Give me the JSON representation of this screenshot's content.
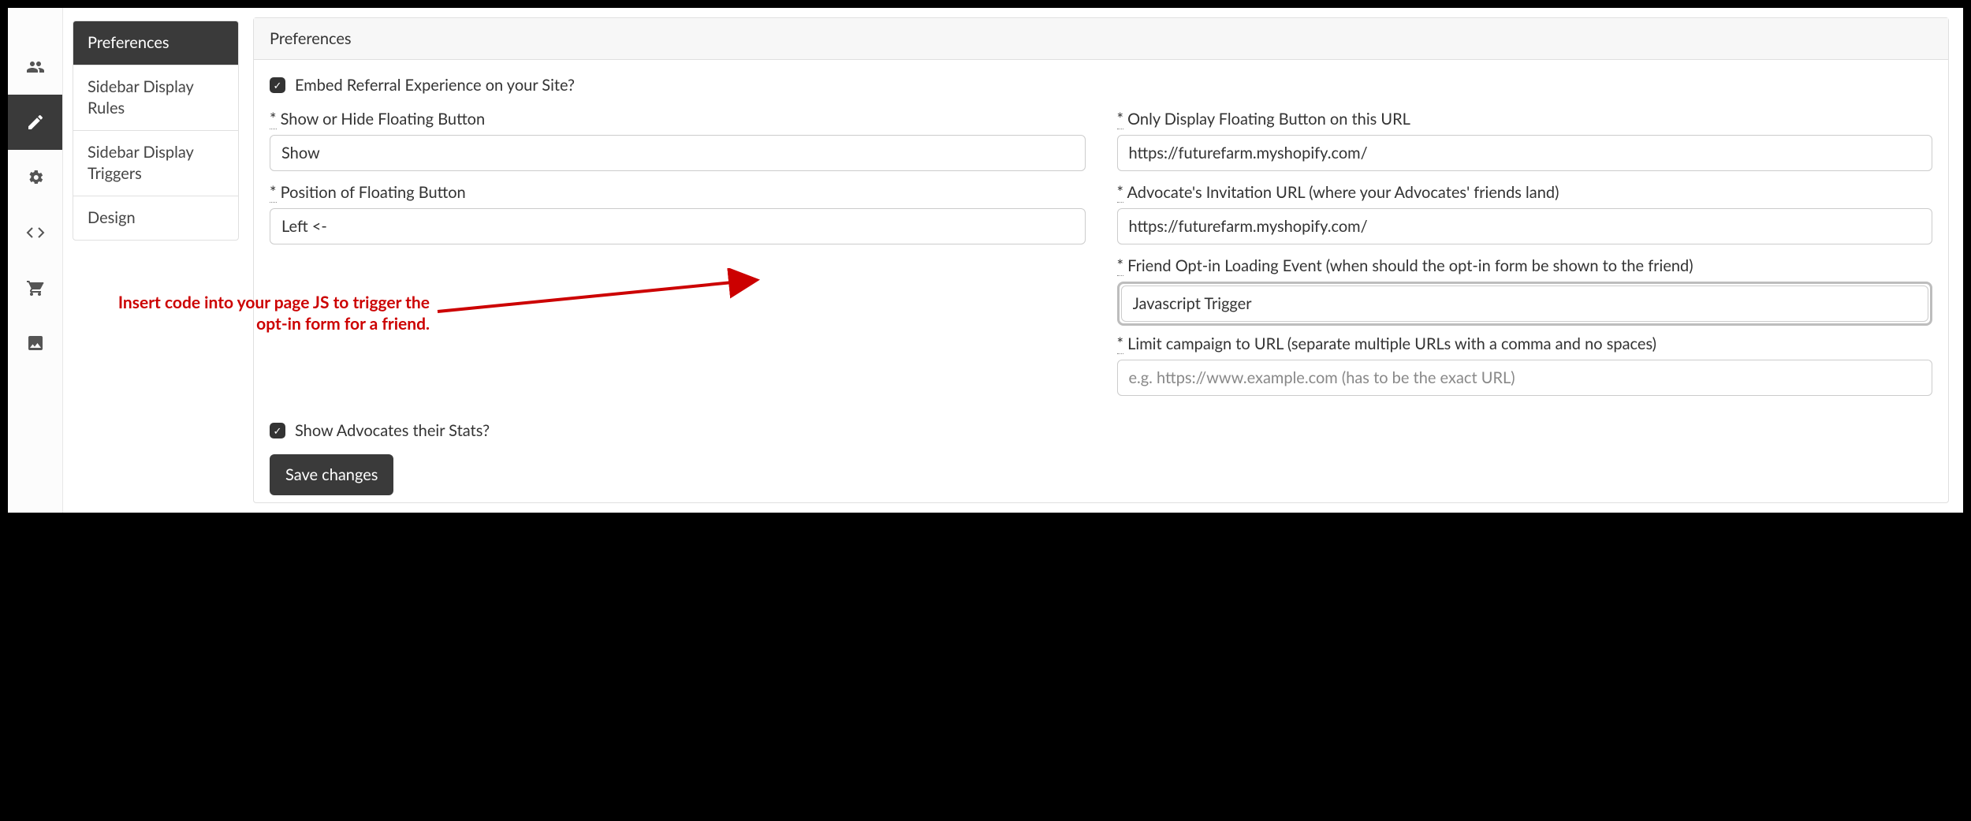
{
  "iconbar": {
    "items": [
      {
        "name": "users"
      },
      {
        "name": "edit"
      },
      {
        "name": "gears"
      },
      {
        "name": "code"
      },
      {
        "name": "cart"
      },
      {
        "name": "image"
      }
    ],
    "activeIndex": 1
  },
  "sidemenu": {
    "items": [
      "Preferences",
      "Sidebar Display Rules",
      "Sidebar Display Triggers",
      "Design"
    ],
    "activeIndex": 0
  },
  "panel": {
    "title": "Preferences"
  },
  "form": {
    "embed_label": "Embed Referral Experience on your Site?",
    "embed_checked": true,
    "show_stats_label": "Show Advocates their Stats?",
    "show_stats_checked": true,
    "left": {
      "show_hide": {
        "label": "Show or Hide Floating Button",
        "value": "Show"
      },
      "position": {
        "label": "Position of Floating Button",
        "value": "Left <-"
      }
    },
    "right": {
      "only_url": {
        "label": "Only Display Floating Button on this URL",
        "value": "https://futurefarm.myshopify.com/"
      },
      "invite_url": {
        "label": "Advocate's Invitation URL (where your Advocates' friends land)",
        "value": "https://futurefarm.myshopify.com/"
      },
      "load_event": {
        "label": "Friend Opt-in Loading Event (when should the opt-in form be shown to the friend)",
        "value": "Javascript Trigger"
      },
      "limit_url": {
        "label": "Limit campaign to URL (separate multiple URLs with a comma and no spaces)",
        "value": "",
        "placeholder": "e.g. https://www.example.com (has to be the exact URL)"
      }
    },
    "save_label": "Save changes"
  },
  "annotation": {
    "text": "Insert code into your page JS to trigger the opt-in form for a friend."
  }
}
